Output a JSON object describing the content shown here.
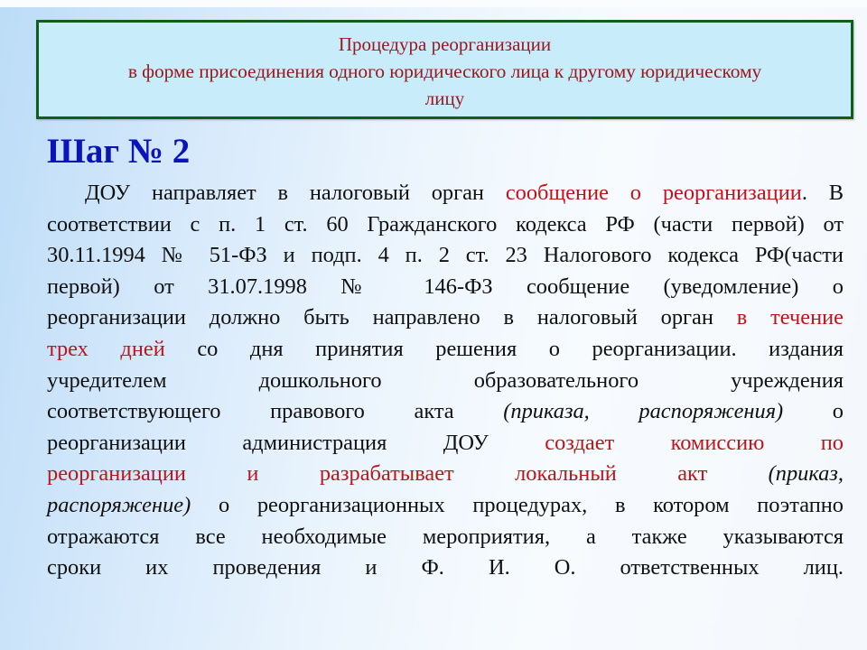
{
  "slide": {
    "title_lines": [
      "Процедура реорганизации",
      "в форме присоединения одного юридического лица к другому юридическому",
      "лицу"
    ],
    "heading": "Шаг № 2",
    "paragraph_rows": [
      [
        {
          "t": "ДОУ направляет в налоговый орган "
        },
        {
          "t": "сообщение о реорганизации",
          "s": "red"
        },
        {
          "t": ". В"
        }
      ],
      [
        {
          "t": "соответствии с п. 1 ст. 60 Гражданского кодекса РФ (части первой) от"
        }
      ],
      [
        {
          "t": "30.11.1994 № 51-ФЗ и подп. 4 п. 2 ст. 23 Налогового кодекса РФ(части"
        }
      ],
      [
        {
          "t": "первой) от 31.07.1998 № 146-ФЗ сообщение (уведомление) о"
        }
      ],
      [
        {
          "t": "реорганизации должно быть направлено в налоговый орган "
        },
        {
          "t": "в течение",
          "s": "red"
        }
      ],
      [
        {
          "t": "трех дней",
          "s": "red"
        },
        {
          "t": " со дня принятия решения о реорганизации. издания"
        }
      ],
      [
        {
          "t": "учредителем дошкольного образовательного учреждения"
        }
      ],
      [
        {
          "t": "соответствующего правового акта "
        },
        {
          "t": "(приказа, распоряжения)",
          "s": "it"
        },
        {
          "t": " о"
        }
      ],
      [
        {
          "t": "реорганизации администрация ДОУ "
        },
        {
          "t": "создает комиссию по",
          "s": "red"
        }
      ],
      [
        {
          "t": "реорганизации и разрабатывает локальный акт",
          "s": "red"
        },
        {
          "t": " "
        },
        {
          "t": "(приказ,",
          "s": "it"
        }
      ],
      [
        {
          "t": "распоряжение)",
          "s": "it"
        },
        {
          "t": " о реорганизационных процедурах, в котором поэтапно"
        }
      ],
      [
        {
          "t": "отражаются все необходимые мероприятия, а также указываются"
        }
      ],
      [
        {
          "t": "сроки их проведения и Ф. И. О. ответственных лиц."
        }
      ]
    ]
  },
  "colors": {
    "title_text": "#a0151e",
    "title_fill": "#c9ecfb",
    "title_border": "#0f5e1c",
    "heading": "#0a14b8",
    "highlight": "#c0141c",
    "body_text": "#111111"
  }
}
